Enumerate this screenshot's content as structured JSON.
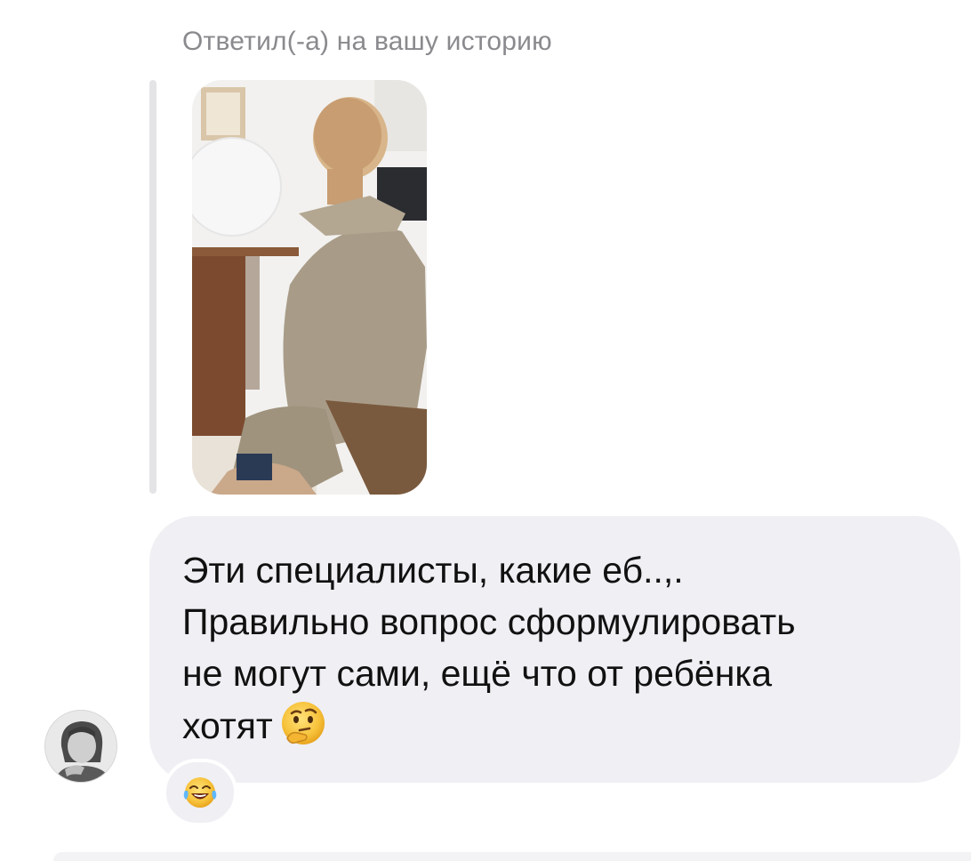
{
  "reply_header": {
    "label": "Ответил(-а) на вашу историю"
  },
  "story": {
    "icon": "story-photo-thumbnail"
  },
  "message": {
    "lines": [
      "Эти специалисты, какие еб..,.",
      "Правильно вопрос сформулировать",
      "не могут сами, ещё что от ребёнка",
      "хотят"
    ],
    "trailing_emoji": "thinking-face-emoji",
    "bubble_color": "#efeff4",
    "text_color": "#111111"
  },
  "sender": {
    "avatar_icon": "user-avatar-photo"
  },
  "reaction": {
    "emoji": "face-with-tears-of-joy-emoji"
  },
  "colors": {
    "label_gray": "#8a8a8e",
    "quote_bar": "#e4e4e7"
  }
}
